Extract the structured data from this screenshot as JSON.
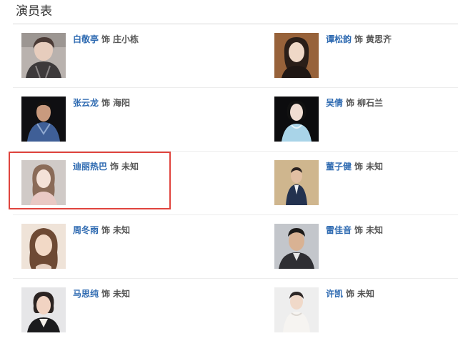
{
  "section": {
    "title": "演员表"
  },
  "connector": "饰",
  "cast": [
    {
      "actor": "白敬亭",
      "role": "庄小栋"
    },
    {
      "actor": "谭松韵",
      "role": "黄思齐"
    },
    {
      "actor": "张云龙",
      "role": "海阳"
    },
    {
      "actor": "吴倩",
      "role": "柳石兰"
    },
    {
      "actor": "迪丽热巴",
      "role": "未知"
    },
    {
      "actor": "董子健",
      "role": "未知"
    },
    {
      "actor": "周冬雨",
      "role": "未知"
    },
    {
      "actor": "雷佳音",
      "role": "未知"
    },
    {
      "actor": "马思纯",
      "role": "未知"
    },
    {
      "actor": "许凯",
      "role": "未知"
    }
  ],
  "colors": {
    "actor_link": "#2e6ab1",
    "highlight_border": "#e0443e"
  }
}
